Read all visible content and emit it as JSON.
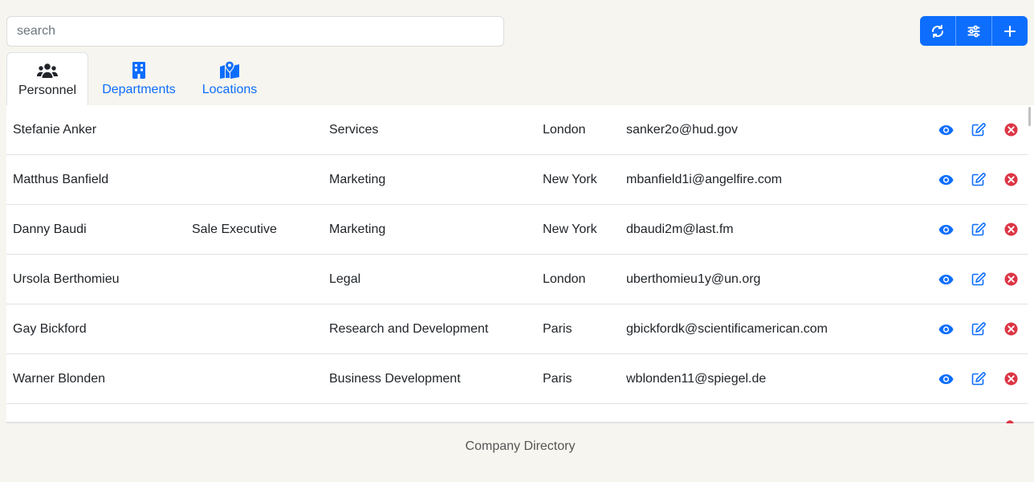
{
  "search": {
    "placeholder": "search"
  },
  "toolbar": {
    "buttons": [
      {
        "icon": "refresh-icon"
      },
      {
        "icon": "filter-sliders-icon"
      },
      {
        "icon": "plus-icon"
      }
    ]
  },
  "tabs": [
    {
      "label": "Personnel",
      "icon": "users-icon",
      "active": true
    },
    {
      "label": "Departments",
      "icon": "building-icon",
      "active": false
    },
    {
      "label": "Locations",
      "icon": "map-location-icon",
      "active": false
    }
  ],
  "personnel": {
    "rows": [
      {
        "name": "Stefanie Anker",
        "job": "",
        "department": "Services",
        "location": "London",
        "email": "sanker2o@hud.gov"
      },
      {
        "name": "Matthus Banfield",
        "job": "",
        "department": "Marketing",
        "location": "New York",
        "email": "mbanfield1i@angelfire.com"
      },
      {
        "name": "Danny Baudi",
        "job": "Sale Executive",
        "department": "Marketing",
        "location": "New York",
        "email": "dbaudi2m@last.fm"
      },
      {
        "name": "Ursola Berthomieu",
        "job": "",
        "department": "Legal",
        "location": "London",
        "email": "uberthomieu1y@un.org"
      },
      {
        "name": "Gay Bickford",
        "job": "",
        "department": "Research and Development",
        "location": "Paris",
        "email": "gbickfordk@scientificamerican.com"
      },
      {
        "name": "Warner Blonden",
        "job": "",
        "department": "Business Development",
        "location": "Paris",
        "email": "wblonden11@spiegel.de"
      }
    ]
  },
  "colors": {
    "primary": "#0d6efd",
    "danger": "#dc3545",
    "background": "#f7f5ef"
  },
  "footer": {
    "text": "Company Directory"
  }
}
